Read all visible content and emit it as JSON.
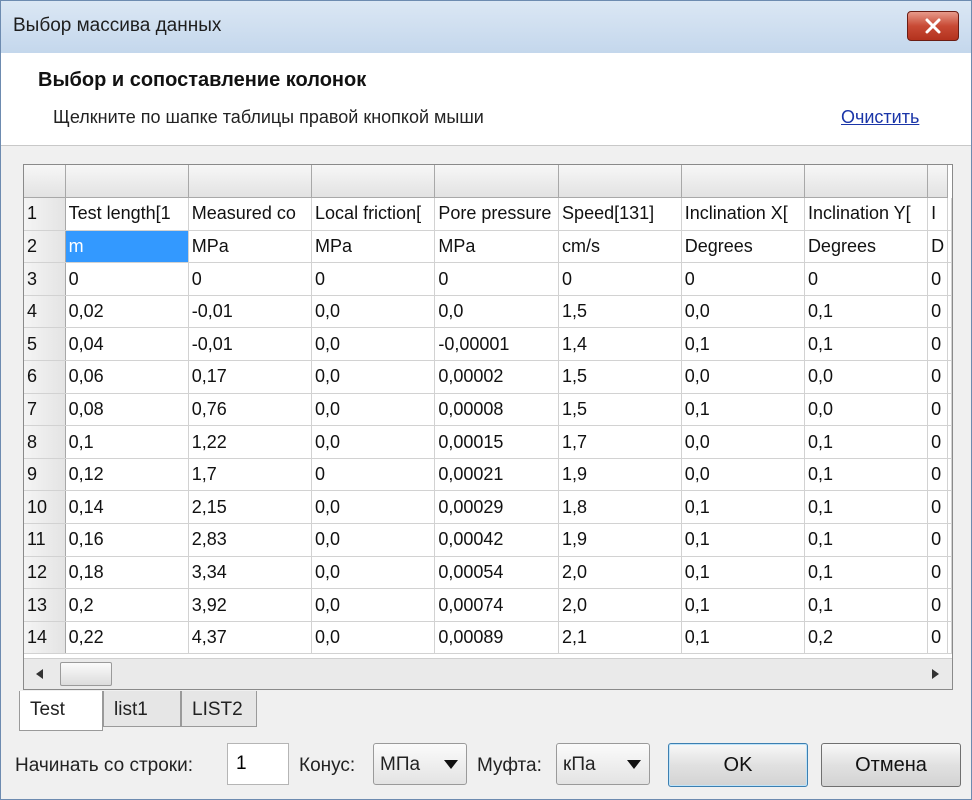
{
  "window": {
    "title": "Выбор массива данных"
  },
  "header": {
    "title": "Выбор и сопоставление колонок",
    "hint": "Щелкните по шапке таблицы правой кнопкой мыши",
    "clear_link": "Очистить"
  },
  "grid": {
    "rows": [
      {
        "num": "1",
        "cells": [
          "Test length[1",
          "Measured co",
          "Local friction[",
          "Pore pressure",
          "Speed[131]",
          "Inclination X[",
          "Inclination Y[",
          "I"
        ]
      },
      {
        "num": "2",
        "cells": [
          "m",
          "MPa",
          "MPa",
          "MPa",
          "cm/s",
          "Degrees",
          "Degrees",
          "D"
        ]
      },
      {
        "num": "3",
        "cells": [
          "0",
          "0",
          "0",
          "0",
          "0",
          "0",
          "0",
          "0"
        ]
      },
      {
        "num": "4",
        "cells": [
          "0,02",
          "-0,01",
          "0,0",
          "0,0",
          "1,5",
          "0,0",
          "0,1",
          "0"
        ]
      },
      {
        "num": "5",
        "cells": [
          "0,04",
          "-0,01",
          "0,0",
          "-0,00001",
          "1,4",
          "0,1",
          "0,1",
          "0"
        ]
      },
      {
        "num": "6",
        "cells": [
          "0,06",
          "0,17",
          "0,0",
          "0,00002",
          "1,5",
          "0,0",
          "0,0",
          "0"
        ]
      },
      {
        "num": "7",
        "cells": [
          "0,08",
          "0,76",
          "0,0",
          "0,00008",
          "1,5",
          "0,1",
          "0,0",
          "0"
        ]
      },
      {
        "num": "8",
        "cells": [
          "0,1",
          "1,22",
          "0,0",
          "0,00015",
          "1,7",
          "0,0",
          "0,1",
          "0"
        ]
      },
      {
        "num": "9",
        "cells": [
          "0,12",
          "1,7",
          "0",
          "0,00021",
          "1,9",
          "0,0",
          "0,1",
          "0"
        ]
      },
      {
        "num": "10",
        "cells": [
          "0,14",
          "2,15",
          "0,0",
          "0,00029",
          "1,8",
          "0,1",
          "0,1",
          "0"
        ]
      },
      {
        "num": "11",
        "cells": [
          "0,16",
          "2,83",
          "0,0",
          "0,00042",
          "1,9",
          "0,1",
          "0,1",
          "0"
        ]
      },
      {
        "num": "12",
        "cells": [
          "0,18",
          "3,34",
          "0,0",
          "0,00054",
          "2,0",
          "0,1",
          "0,1",
          "0"
        ]
      },
      {
        "num": "13",
        "cells": [
          "0,2",
          "3,92",
          "0,0",
          "0,00074",
          "2,0",
          "0,1",
          "0,1",
          "0"
        ]
      },
      {
        "num": "14",
        "cells": [
          "0,22",
          "4,37",
          "0,0",
          "0,00089",
          "2,1",
          "0,1",
          "0,2",
          "0"
        ]
      }
    ],
    "selected_cell": "1.0"
  },
  "tabs": [
    {
      "label": "Test",
      "active": true
    },
    {
      "label": "list1",
      "active": false
    },
    {
      "label": "LIST2",
      "active": false
    }
  ],
  "bottom": {
    "start_row_label": "Начинать со строки:",
    "start_row_value": "1",
    "cone_label": "Конус:",
    "cone_value": "МПа",
    "muff_label": "Муфта:",
    "muff_value": "кПа",
    "ok_label": "OK",
    "cancel_label": "Отмена"
  },
  "icons": {
    "close": "close-icon",
    "scroll_left": "scroll-left-arrow-icon",
    "scroll_right": "scroll-right-arrow-icon",
    "dropdown": "chevron-down-icon"
  },
  "colors": {
    "selection": "#3399ff",
    "link": "#1a35a8",
    "close_button": "#c84a35"
  }
}
